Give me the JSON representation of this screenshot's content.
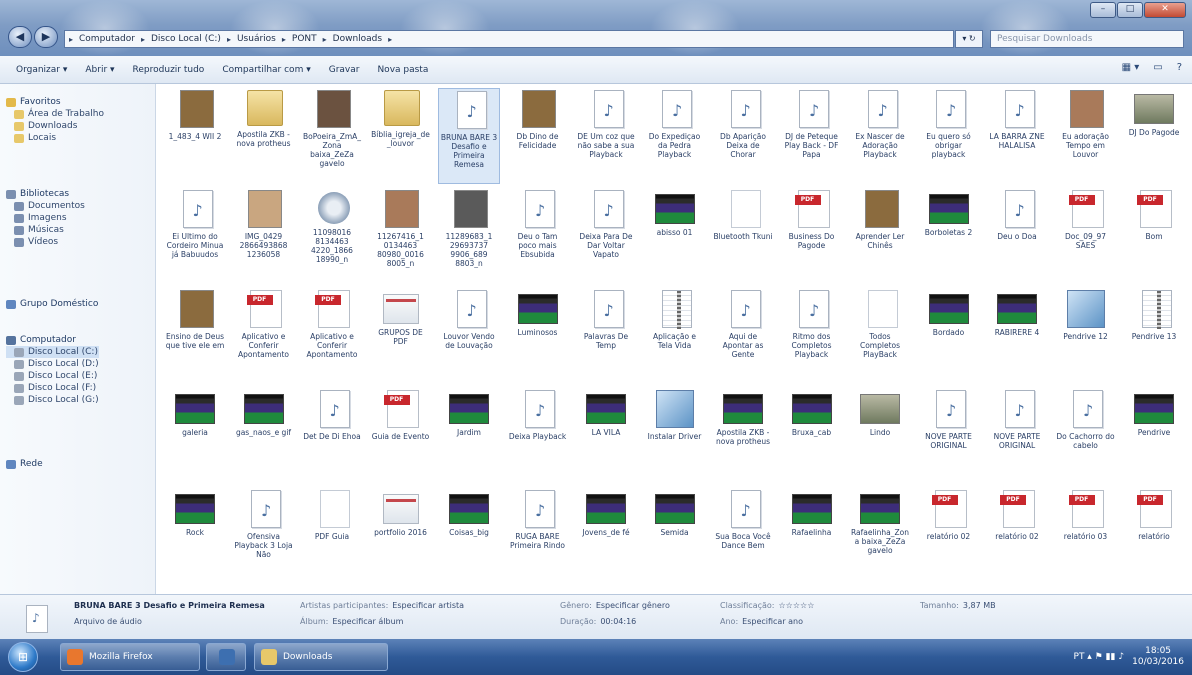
{
  "window": {
    "nav_back": "◀",
    "nav_forward": "▶",
    "minimize": "–",
    "maximize": "□",
    "close": "✕",
    "breadcrumbs": [
      "Computador",
      "Disco Local (C:)",
      "Usuários",
      "PONT",
      "Downloads"
    ],
    "address_tools": "▾ ↻",
    "search_placeholder": "Pesquisar Downloads"
  },
  "toolbar": {
    "items": [
      "Organizar ▾",
      "Abrir ▾",
      "Reproduzir tudo",
      "Compartilhar com ▾",
      "Gravar",
      "Nova pasta"
    ],
    "view_toggle": "▦ ▾",
    "pane_toggle": "▭",
    "help": "?"
  },
  "navpane": {
    "favorites_head": "Favoritos",
    "favorites": [
      "Área de Trabalho",
      "Downloads",
      "Locais"
    ],
    "libraries_head": "Bibliotecas",
    "libraries": [
      "Documentos",
      "Imagens",
      "Músicas",
      "Vídeos"
    ],
    "homegroup": "Grupo Doméstico",
    "computer_head": "Computador",
    "drives": [
      "Disco Local (C:)",
      "Disco Local (D:)",
      "Disco Local (E:)",
      "Disco Local (F:)",
      "Disco Local (G:)"
    ],
    "network": "Rede"
  },
  "files": [
    {
      "icon": "photo-icon",
      "name": "1_483_4 WII 2"
    },
    {
      "icon": "folder-icon",
      "name": "Apostila ZKB - nova protheus"
    },
    {
      "icon": "photo-icon",
      "name": "BoPoeira_ZmA_Zona baixa_ZeZa gavelo"
    },
    {
      "icon": "folder-icon",
      "name": "Bíblia_igreja_de_louvor"
    },
    {
      "icon": "audio-icon",
      "name": "BRUNA BARE 3 Desafio e Primeira Remesa",
      "selected": true
    },
    {
      "icon": "photo-icon",
      "name": "Db Dino de Felicidade"
    },
    {
      "icon": "audio-icon",
      "name": "DE Um coz que não sabe a sua Playback"
    },
    {
      "icon": "audio-icon",
      "name": "Do Expediçao da Pedra Playback"
    },
    {
      "icon": "audio-icon",
      "name": "Db Aparição Deixa de Chorar"
    },
    {
      "icon": "audio-icon",
      "name": "DJ de Peteque Play Back - DF Papa"
    },
    {
      "icon": "audio-icon",
      "name": "Ex Nascer de Adoração Playback"
    },
    {
      "icon": "audio-icon",
      "name": "Eu quero só obrigar playback"
    },
    {
      "icon": "audio-icon",
      "name": "LA BARRA ZNE HALALISA"
    },
    {
      "icon": "photo-icon",
      "name": "Eu adoração Tempo em Louvor"
    },
    {
      "icon": "image-icon",
      "name": "DJ Do Pagode"
    },
    {
      "icon": "audio-icon",
      "name": "Ei Ultimo do Cordeiro Minua já Babuudos"
    },
    {
      "icon": "photo-icon",
      "name": "IMG_0429 2866493868 1236058"
    },
    {
      "icon": "gear-icon",
      "name": "11098016 8134463 4220_1866 18990_n"
    },
    {
      "icon": "photo-icon",
      "name": "11267416_1 0134463 80980_0016 8005_n"
    },
    {
      "icon": "photo-icon",
      "name": "11289683_1 29693737 9906_689 8803_n"
    },
    {
      "icon": "audio-icon",
      "name": "Deu o Tam poco mais Ebsubida"
    },
    {
      "icon": "audio-icon",
      "name": "Deixa Para De Dar Voltar Vapato"
    },
    {
      "icon": "video-icon",
      "name": "abisso 01"
    },
    {
      "icon": "blank-icon",
      "name": "Bluetooth Tkuni"
    },
    {
      "icon": "pdf-icon",
      "name": "Business Do Pagode"
    },
    {
      "icon": "photo-icon",
      "name": "Aprender Ler Chinês"
    },
    {
      "icon": "video-icon",
      "name": "Borboletas 2"
    },
    {
      "icon": "audio-icon",
      "name": "Deu o Doa"
    },
    {
      "icon": "pdf-icon",
      "name": "Doc_09_97 SAES"
    },
    {
      "icon": "pdf-icon",
      "name": "Bom"
    },
    {
      "icon": "photo-icon",
      "name": "Ensino de Deus que tive ele em"
    },
    {
      "icon": "pdf-icon",
      "name": "Aplicativo e Conferir Apontamento"
    },
    {
      "icon": "pdf-icon",
      "name": "Aplicativo e Conferir Apontamento"
    },
    {
      "icon": "shot-icon",
      "name": "GRUPOS DE PDF"
    },
    {
      "icon": "audio-icon",
      "name": "Louvor Vendo de Louvação"
    },
    {
      "icon": "video-icon",
      "name": "Luminosos"
    },
    {
      "icon": "audio-icon",
      "name": "Palavras De Temp"
    },
    {
      "icon": "zip-icon",
      "name": "Aplicação e Tela Vida"
    },
    {
      "icon": "audio-icon",
      "name": "Aqui de Apontar as Gente"
    },
    {
      "icon": "audio-icon",
      "name": "Ritmo dos Completos Playback"
    },
    {
      "icon": "blank-icon",
      "name": "Todos Completos PlayBack"
    },
    {
      "icon": "video-icon",
      "name": "Bordado"
    },
    {
      "icon": "video-icon",
      "name": "RABIRERE 4"
    },
    {
      "icon": "setup-icon",
      "name": "Pendrive 12"
    },
    {
      "icon": "zip-icon",
      "name": "Pendrive 13"
    },
    {
      "icon": "video-icon",
      "name": "galeria"
    },
    {
      "icon": "video-icon",
      "name": "gas_naos_e gif"
    },
    {
      "icon": "audio-icon",
      "name": "Det De Di Ehoa"
    },
    {
      "icon": "pdf-icon",
      "name": "Guia de Evento"
    },
    {
      "icon": "video-icon",
      "name": "Jardim"
    },
    {
      "icon": "audio-icon",
      "name": "Deixa Playback"
    },
    {
      "icon": "video-icon",
      "name": "LA VILA"
    },
    {
      "icon": "setup-icon",
      "name": "Instalar Driver"
    },
    {
      "icon": "video-icon",
      "name": "Apostila ZKB - nova protheus"
    },
    {
      "icon": "video-icon",
      "name": "Bruxa_cab"
    },
    {
      "icon": "image-icon",
      "name": "Lindo"
    },
    {
      "icon": "audio-icon",
      "name": "NOVE PARTE ORIGINAL"
    },
    {
      "icon": "audio-icon",
      "name": "NOVE PARTE ORIGINAL"
    },
    {
      "icon": "audio-icon",
      "name": "Do Cachorro do cabelo"
    },
    {
      "icon": "video-icon",
      "name": "Pendrive"
    },
    {
      "icon": "video-icon",
      "name": "Rock"
    },
    {
      "icon": "audio-icon",
      "name": "Ofensiva Playback 3 Loja Não"
    },
    {
      "icon": "blank-icon",
      "name": "PDF Guia"
    },
    {
      "icon": "shot-icon",
      "name": "portfolio 2016"
    },
    {
      "icon": "video-icon",
      "name": "Coisas_big"
    },
    {
      "icon": "audio-icon",
      "name": "RUGA BARE Primeira Rindo"
    },
    {
      "icon": "video-icon",
      "name": "Jovens_de fé"
    },
    {
      "icon": "video-icon",
      "name": "Semida"
    },
    {
      "icon": "audio-icon",
      "name": "Sua Boca Você Dance Bem"
    },
    {
      "icon": "video-icon",
      "name": "Rafaelinha"
    },
    {
      "icon": "video-icon",
      "name": "Rafaelinha_Zona baixa_ZeZa gavelo"
    },
    {
      "icon": "pdf-icon",
      "name": "relatório 02"
    },
    {
      "icon": "pdf-icon",
      "name": "relatório 02"
    },
    {
      "icon": "pdf-icon",
      "name": "relatório 03"
    },
    {
      "icon": "pdf-icon",
      "name": "relatório"
    }
  ],
  "details": {
    "title": "BRUNA BARE 3 Desafio e Primeira Remesa",
    "type": "Arquivo de áudio",
    "contributing_label": "Artistas participantes:",
    "contributing_value": "Especificar artista",
    "album_label": "Álbum:",
    "album_value": "Especificar álbum",
    "genre_label": "Gênero:",
    "genre_value": "Especificar gênero",
    "length_label": "Duração:",
    "length_value": "00:04:16",
    "size_label": "Tamanho:",
    "size_value": "3,87 MB",
    "year_label": "Ano:",
    "year_value": "Especificar ano",
    "rating_label": "Classificação:",
    "rating_value": "☆☆☆☆☆"
  },
  "taskbar": {
    "start": "⊞",
    "buttons": [
      "Mozilla Firefox",
      "",
      "Downloads"
    ],
    "tray_icons": "PT  ▴  ⚑  ▮▮  ♪",
    "time": "18:05",
    "date": "10/03/2016"
  }
}
